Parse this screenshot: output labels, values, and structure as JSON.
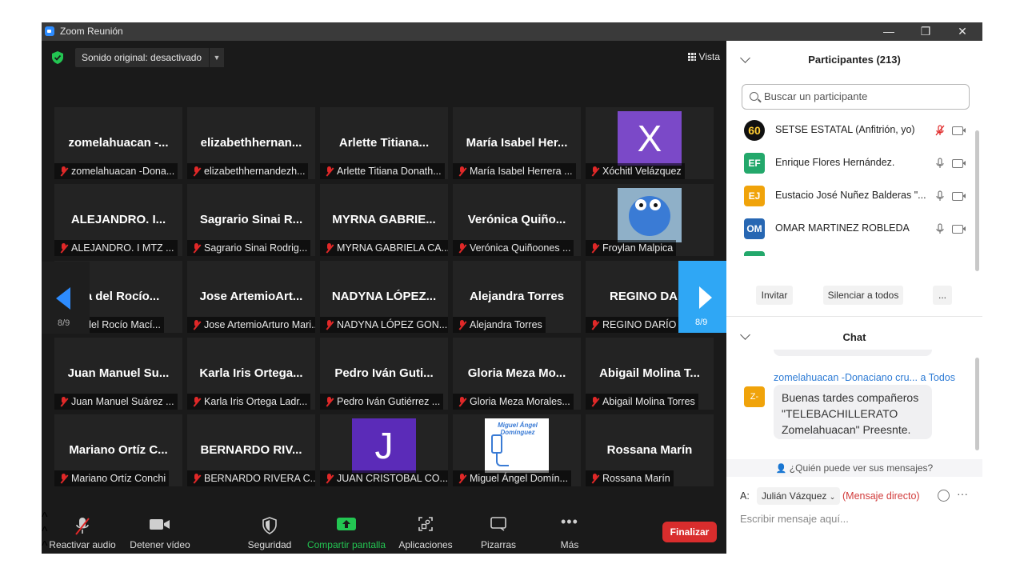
{
  "window": {
    "title": "Zoom Reunión",
    "controls": [
      "—",
      "❐",
      "✕"
    ]
  },
  "video": {
    "sound_label": "Sonido original: desactivado",
    "view_label": "Vista",
    "page_indicator_left": "8/9",
    "page_indicator_right": "8/9",
    "tiles": [
      {
        "big": "zomelahuacan -...",
        "name": "zomelahuacan -Dona..."
      },
      {
        "big": "elizabethhernan...",
        "name": "elizabethhernandezh..."
      },
      {
        "big": "Arlette Titiana...",
        "name": "Arlette Titiana Donath..."
      },
      {
        "big": "María Isabel Her...",
        "name": "María Isabel Herrera ..."
      },
      {
        "big": "X",
        "name": "Xóchitl Velázquez"
      },
      {
        "big": "ALEJANDRO. I...",
        "name": "ALEJANDRO. I MTZ ..."
      },
      {
        "big": "Sagrario Sinai R...",
        "name": "Sagrario Sinai Rodrig..."
      },
      {
        "big": "MYRNA GABRIE...",
        "name": "MYRNA GABRIELA CA..."
      },
      {
        "big": "Verónica Quiño...",
        "name": "Verónica Quiñoones ..."
      },
      {
        "big": "",
        "name": "Froylan Malpica"
      },
      {
        "big": "ría del Rocío...",
        "name": "ría del Rocío Mací..."
      },
      {
        "big": "Jose ArtemioArt...",
        "name": "Jose ArtemioArturo Mari..."
      },
      {
        "big": "NADYNA LÓPEZ...",
        "name": "NADYNA LÓPEZ GON..."
      },
      {
        "big": "Alejandra Torres",
        "name": "Alejandra Torres"
      },
      {
        "big": "REGINO DARÍ",
        "name": "REGINO DARÍO"
      },
      {
        "big": "Juan Manuel Su...",
        "name": "Juan Manuel Suárez ..."
      },
      {
        "big": "Karla Iris Ortega...",
        "name": "Karla Iris Ortega Ladr..."
      },
      {
        "big": "Pedro Iván Guti...",
        "name": "Pedro Iván Gutiérrez ..."
      },
      {
        "big": "Gloria Meza Mo...",
        "name": "Gloria Meza Morales..."
      },
      {
        "big": "Abigail Molina T...",
        "name": "Abigail Molina Torres"
      },
      {
        "big": "Mariano Ortíz C...",
        "name": "Mariano Ortíz Conchi"
      },
      {
        "big": "BERNARDO RIV...",
        "name": "BERNARDO RIVERA C..."
      },
      {
        "big": "J",
        "name": "JUAN CRISTOBAL CO..."
      },
      {
        "big": "",
        "name": "Miguel Ángel Domín..."
      },
      {
        "big": "Rossana Marín",
        "name": "Rossana Marín"
      }
    ],
    "miguel_logo_text": "Miguel Ángel Domínguez"
  },
  "toolbar": {
    "unmute": "Reactivar audio",
    "stop_video": "Detener vídeo",
    "security": "Seguridad",
    "share": "Compartir pantalla",
    "apps": "Aplicaciones",
    "whiteboards": "Pizarras",
    "more": "Más",
    "end": "Finalizar"
  },
  "participants": {
    "header": "Participantes (213)",
    "search_placeholder": "Buscar un participante",
    "list": [
      {
        "initials": "60",
        "name": "SETSE ESTATAL (Anfitrión, yo)",
        "color": "#1f1f1f"
      },
      {
        "initials": "EF",
        "name": "Enrique Flores Hernández.",
        "color": "#23a86b"
      },
      {
        "initials": "EJ",
        "name": "Eustacio José Nuñez Balderas \"...",
        "color": "#f0a30a"
      },
      {
        "initials": "OM",
        "name": "OMAR MARTINEZ ROBLEDA",
        "color": "#2767b3"
      }
    ],
    "invite": "Invitar",
    "mute_all": "Silenciar a todos",
    "more": "..."
  },
  "chat": {
    "header": "Chat",
    "from": "zomelahuacan -Donaciano cru...",
    "to": "a Todos",
    "avatar": "Z-",
    "message": "Buenas tardes compañeros \"TELEBACHILLERATO Zomelahuacan\" Preesnte.",
    "who_can_see": "¿Quién puede ver sus mensajes?",
    "to_label": "A:",
    "recipient": "Julián Vázquez",
    "direct": "(Mensaje directo)",
    "placeholder": "Escribir mensaje aquí..."
  },
  "colors": {
    "accent": "#2d8cff",
    "end": "#d92d2d",
    "share": "#23c552"
  }
}
